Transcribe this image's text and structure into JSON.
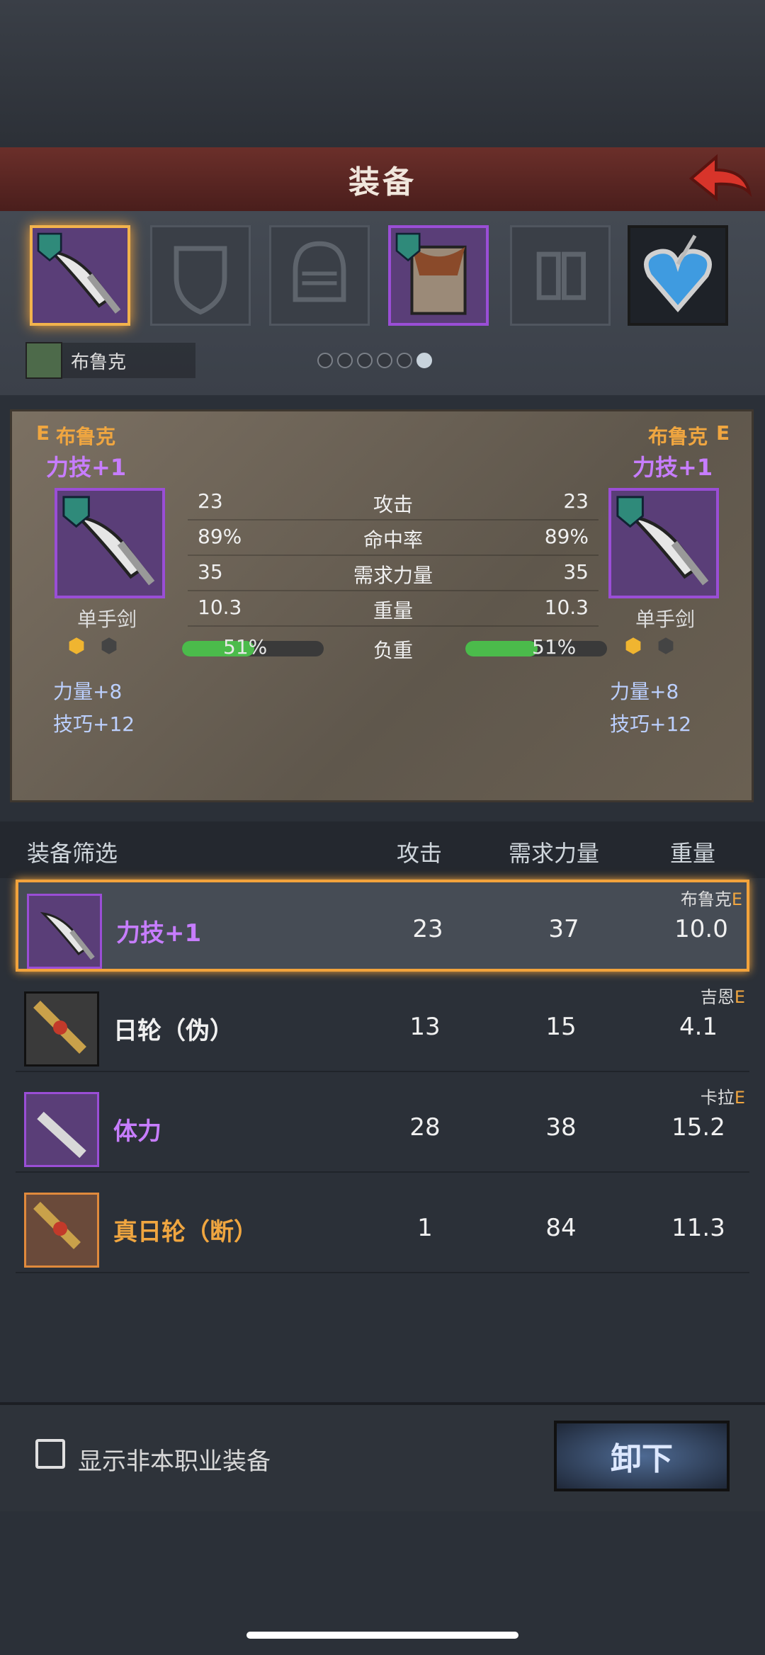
{
  "header": {
    "title": "装备"
  },
  "slots_bar": {
    "hero_name": "布鲁克",
    "page_count": 6,
    "active_page": 6
  },
  "compare": {
    "left": {
      "rank": "E",
      "hero": "布鲁克",
      "skill": "力技+1",
      "type": "单手剑",
      "bonus1": "力量+8",
      "bonus2": "技巧+12"
    },
    "right": {
      "rank": "E",
      "hero": "布鲁克",
      "skill": "力技+1",
      "type": "单手剑",
      "bonus1": "力量+8",
      "bonus2": "技巧+12"
    },
    "stats": [
      {
        "name": "攻击",
        "left": "23",
        "right": "23"
      },
      {
        "name": "命中率",
        "left": "89%",
        "right": "89%"
      },
      {
        "name": "需求力量",
        "left": "35",
        "right": "35"
      },
      {
        "name": "重量",
        "left": "10.3",
        "right": "10.3"
      },
      {
        "name": "负重",
        "left": "51%",
        "right": "51%"
      }
    ],
    "load_fraction": 0.51
  },
  "list": {
    "headers": {
      "filter": "装备筛选",
      "attack": "攻击",
      "str_req": "需求力量",
      "weight": "重量"
    },
    "rows": [
      {
        "name": "力技+1",
        "owner": "布鲁克",
        "rank": "E",
        "attack": "23",
        "str_req": "37",
        "weight": "10.0",
        "name_color": "#c77dff"
      },
      {
        "name": "日轮（伪）",
        "owner": "吉恩",
        "rank": "E",
        "attack": "13",
        "str_req": "15",
        "weight": "4.1",
        "name_color": "#f0f0f0"
      },
      {
        "name": "体力",
        "owner": "卡拉",
        "rank": "E",
        "attack": "28",
        "str_req": "38",
        "weight": "15.2",
        "name_color": "#c77dff"
      },
      {
        "name": "真日轮（断）",
        "owner": "",
        "rank": "",
        "attack": "1",
        "str_req": "84",
        "weight": "11.3",
        "name_color": "#f0a640"
      }
    ]
  },
  "footer": {
    "checkbox_label": "显示非本职业装备",
    "unequip_label": "卸下"
  }
}
